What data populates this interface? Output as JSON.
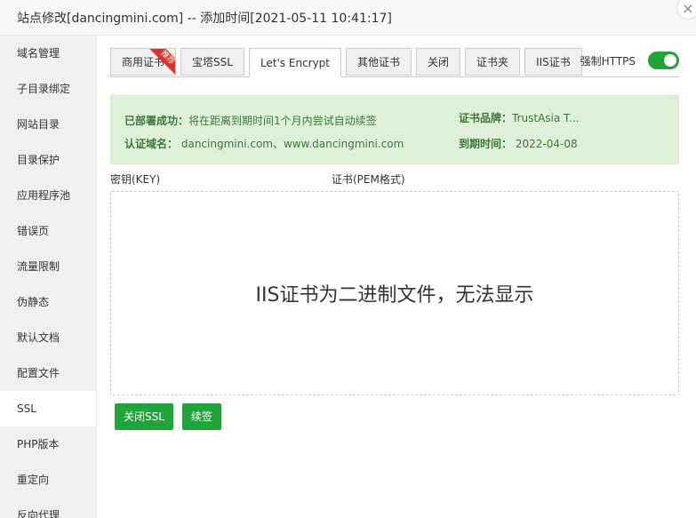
{
  "window": {
    "title": "站点修改[dancingmini.com] -- 添加时间[2021-05-11 10:41:17]"
  },
  "sidebar": {
    "items": [
      {
        "label": "域名管理"
      },
      {
        "label": "子目录绑定"
      },
      {
        "label": "网站目录"
      },
      {
        "label": "目录保护"
      },
      {
        "label": "应用程序池"
      },
      {
        "label": "错误页"
      },
      {
        "label": "流量限制"
      },
      {
        "label": "伪静态"
      },
      {
        "label": "默认文档"
      },
      {
        "label": "配置文件"
      },
      {
        "label": "SSL",
        "active": true
      },
      {
        "label": "PHP版本"
      },
      {
        "label": "重定向"
      },
      {
        "label": "反向代理"
      }
    ]
  },
  "tabs": [
    {
      "label": "商用证书",
      "badge": "推荐"
    },
    {
      "label": "宝塔SSL"
    },
    {
      "label": "Let's Encrypt",
      "active": true
    },
    {
      "label": "其他证书"
    },
    {
      "label": "关闭"
    },
    {
      "label": "证书夹"
    },
    {
      "label": "IIS证书"
    }
  ],
  "https": {
    "label": "强制HTTPS",
    "enabled": true
  },
  "info": {
    "deploy_label": "已部署成功：",
    "deploy_text": "将在距离到期时间1个月内尝试自动续签",
    "brand_label": "证书品牌：",
    "brand_value": "TrustAsia T...",
    "domain_label": "认证域名：",
    "domain_value": "dancingmini.com、www.dancingmini.com",
    "expire_label": "到期时间：",
    "expire_value": "2022-04-08"
  },
  "fields": {
    "key_label": "密钥(KEY)",
    "cert_label": "证书(PEM格式)"
  },
  "cert_message": "IIS证书为二进制文件，无法显示",
  "actions": {
    "close_ssl": "关闭SSL",
    "renew": "续签"
  },
  "colors": {
    "accent": "#20a53a",
    "info_bg": "#dff0d8",
    "info_text": "#3c763d",
    "ribbon": "#d9342b"
  }
}
